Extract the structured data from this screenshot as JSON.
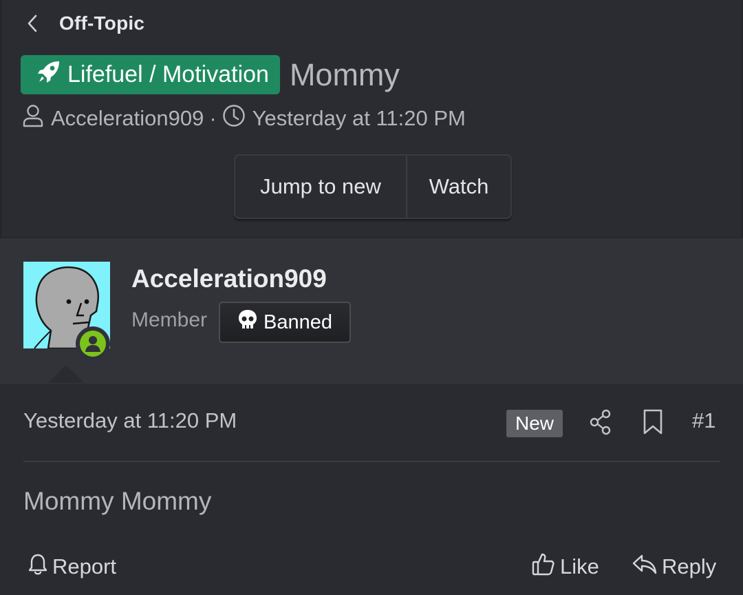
{
  "header": {
    "breadcrumb": "Off-Topic",
    "prefix": "Lifefuel / Motivation",
    "thread_title": "Mommy",
    "author": "Acceleration909",
    "separator": "·",
    "timestamp": "Yesterday at 11:20 PM",
    "buttons": {
      "jump_label": "Jump to new",
      "watch_label": "Watch"
    }
  },
  "user": {
    "username": "Acceleration909",
    "title": "Member",
    "banner": "Banned",
    "avatar_bg": "#7ff2fb",
    "status_color": "#7cc31c"
  },
  "post": {
    "date": "Yesterday at 11:20 PM",
    "new_badge": "New",
    "number": "#1",
    "body": "Mommy Mommy",
    "actions": {
      "report": "Report",
      "like": "Like",
      "reply": "Reply"
    }
  },
  "colors": {
    "prefix_bg": "#1f8a60",
    "background": "#2b2c31"
  },
  "icons": [
    "chevron-left-icon",
    "rocket-icon",
    "user-icon",
    "clock-icon",
    "skull-icon",
    "share-icon",
    "bookmark-icon",
    "bell-icon",
    "thumbs-up-icon",
    "reply-icon",
    "online-status-icon"
  ]
}
